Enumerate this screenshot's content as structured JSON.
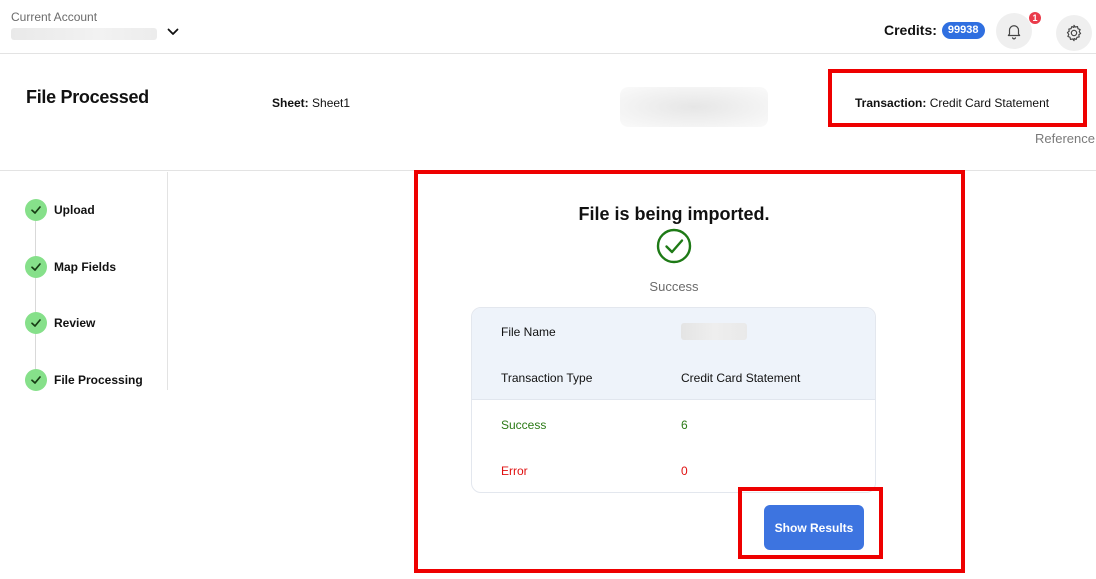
{
  "topbar": {
    "account_label": "Current Account",
    "account_value": "",
    "credits_label": "Credits:",
    "credits_value": "99938",
    "notification_count": "1",
    "icons": [
      "chevron-down-icon",
      "bell-icon",
      "gear-icon"
    ]
  },
  "header": {
    "title": "File Processed",
    "sheet_label": "Sheet:",
    "sheet_value": "Sheet1",
    "transaction_label": "Transaction:",
    "transaction_value": "Credit Card Statement",
    "reference_label": "Reference"
  },
  "steps": [
    {
      "label": "Upload",
      "status": "complete"
    },
    {
      "label": "Map Fields",
      "status": "complete"
    },
    {
      "label": "Review",
      "status": "complete"
    },
    {
      "label": "File Processing",
      "status": "complete"
    }
  ],
  "main": {
    "title": "File is being imported.",
    "status": "Success",
    "summary": {
      "file_name_label": "File Name",
      "file_name_value": "",
      "transaction_type_label": "Transaction Type",
      "transaction_type_value": "Credit Card Statement",
      "success_label": "Success",
      "success_count": "6",
      "error_label": "Error",
      "error_count": "0"
    },
    "button_label": "Show Results"
  },
  "colors": {
    "accent": "#3d74e0",
    "credits_badge": "#2f6fe0",
    "success": "#2b7a16",
    "error": "#e01010",
    "step_complete": "#86e08a",
    "highlight": "#ee0000"
  }
}
